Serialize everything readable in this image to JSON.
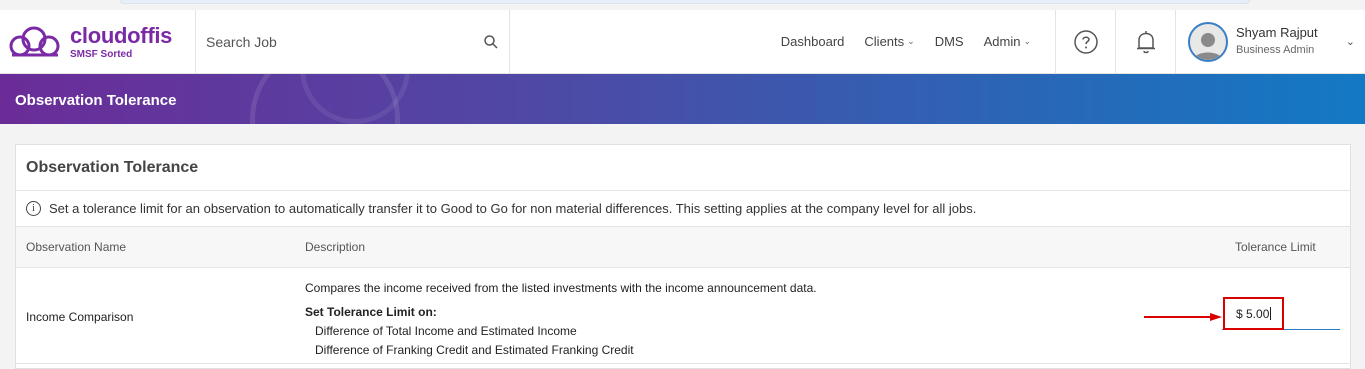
{
  "logo": {
    "name": "cloudoffis",
    "tagline": "SMSF Sorted"
  },
  "search": {
    "placeholder": "Search Job"
  },
  "nav": [
    {
      "label": "Dashboard",
      "dropdown": false
    },
    {
      "label": "Clients",
      "dropdown": true
    },
    {
      "label": "DMS",
      "dropdown": false
    },
    {
      "label": "Admin",
      "dropdown": true
    }
  ],
  "user": {
    "name": "Shyam Rajput",
    "role": "Business Admin"
  },
  "banner": {
    "title": "Observation Tolerance"
  },
  "card": {
    "title": "Observation Tolerance",
    "info": "Set a tolerance limit for an observation to automatically transfer it to Good to Go for non material differences. This setting applies at the company level for all jobs.",
    "columns": {
      "name": "Observation Name",
      "description": "Description",
      "tolerance": "Tolerance Limit"
    },
    "rows": [
      {
        "name": "Income Comparison",
        "description": "Compares the income received from the listed investments with the income announcement data.",
        "set_label": "Set Tolerance Limit on:",
        "items": [
          "Difference of Total Income and Estimated Income",
          "Difference of Franking Credit and Estimated Franking Credit"
        ],
        "tolerance": "$ 5.00"
      }
    ]
  },
  "colors": {
    "brand": "#7b2aa6",
    "highlight": "#d90000",
    "input_underline": "#2a7ac7"
  }
}
